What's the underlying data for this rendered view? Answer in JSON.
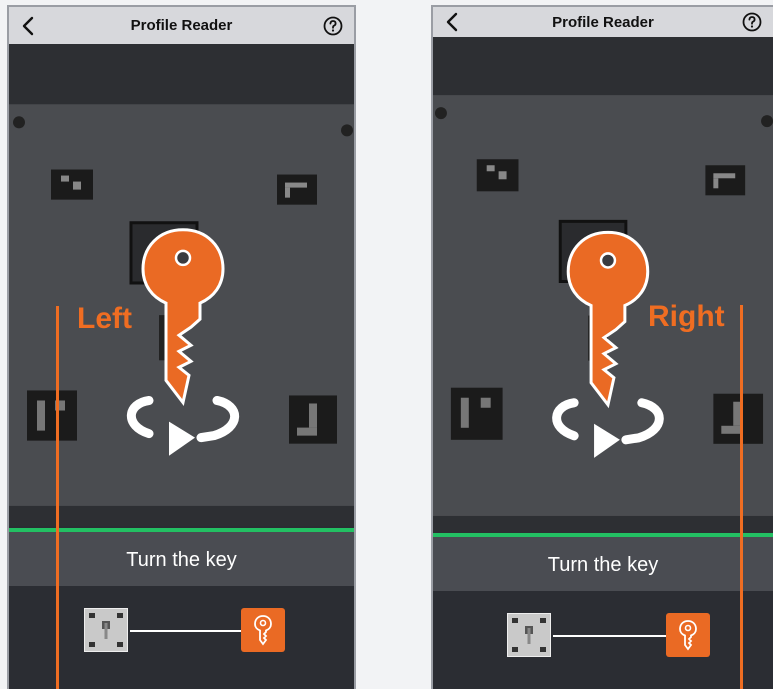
{
  "screens": [
    {
      "title": "Profile Reader",
      "direction_label": "Left",
      "instruction": "Turn the key"
    },
    {
      "title": "Profile Reader",
      "direction_label": "Right",
      "instruction": "Turn the key"
    }
  ],
  "icons": {
    "back": "chevron-left-icon",
    "help": "help-circle-icon",
    "key": "key-icon",
    "rotate": "rotate-arrow-icon"
  },
  "colors": {
    "accent": "#ef6d22",
    "success_line": "#23c063",
    "navbar": "#d7d8dc"
  }
}
